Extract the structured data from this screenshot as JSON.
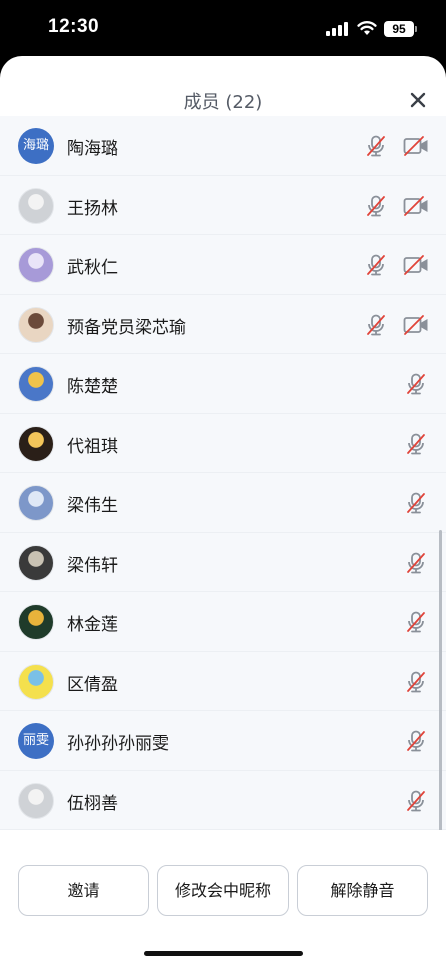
{
  "status_bar": {
    "time": "12:30",
    "battery": "95"
  },
  "sheet": {
    "title": "成员 (22)"
  },
  "members": [
    {
      "name": "陶海璐",
      "avatar_type": "text",
      "avatar_text": "海璐",
      "mic": "muted",
      "camera": "off"
    },
    {
      "name": "王扬林",
      "avatar_type": "image",
      "avatar_icon": "photo-avatar",
      "mic": "muted",
      "camera": "off"
    },
    {
      "name": "武秋仁",
      "avatar_type": "image",
      "avatar_icon": "photo-avatar",
      "mic": "muted",
      "camera": "off"
    },
    {
      "name": "预备党员梁芯瑜",
      "avatar_type": "image",
      "avatar_icon": "cartoon-avatar",
      "mic": "muted",
      "camera": "off"
    },
    {
      "name": "陈楚楚",
      "avatar_type": "image",
      "avatar_icon": "photo-avatar",
      "mic": "muted"
    },
    {
      "name": "代祖琪",
      "avatar_type": "image",
      "avatar_icon": "cartoon-avatar",
      "mic": "muted"
    },
    {
      "name": "梁伟生",
      "avatar_type": "image",
      "avatar_icon": "photo-avatar",
      "mic": "muted"
    },
    {
      "name": "梁伟轩",
      "avatar_type": "image",
      "avatar_icon": "photo-avatar",
      "mic": "muted"
    },
    {
      "name": "林金莲",
      "avatar_type": "image",
      "avatar_icon": "photo-avatar",
      "mic": "muted"
    },
    {
      "name": "区倩盈",
      "avatar_type": "image",
      "avatar_icon": "photo-avatar",
      "mic": "muted"
    },
    {
      "name": "孙孙孙孙丽雯",
      "avatar_type": "text",
      "avatar_text": "丽雯",
      "mic": "muted"
    },
    {
      "name": "伍栩善",
      "avatar_type": "image",
      "avatar_icon": "cartoon-avatar",
      "mic": "muted"
    }
  ],
  "footer": {
    "invite_label": "邀请",
    "rename_label": "修改会中昵称",
    "unmute_label": "解除静音"
  },
  "colors": {
    "accent": "#3d6fc4",
    "muted_red": "#e0443a",
    "icon_gray": "#8a9099"
  }
}
